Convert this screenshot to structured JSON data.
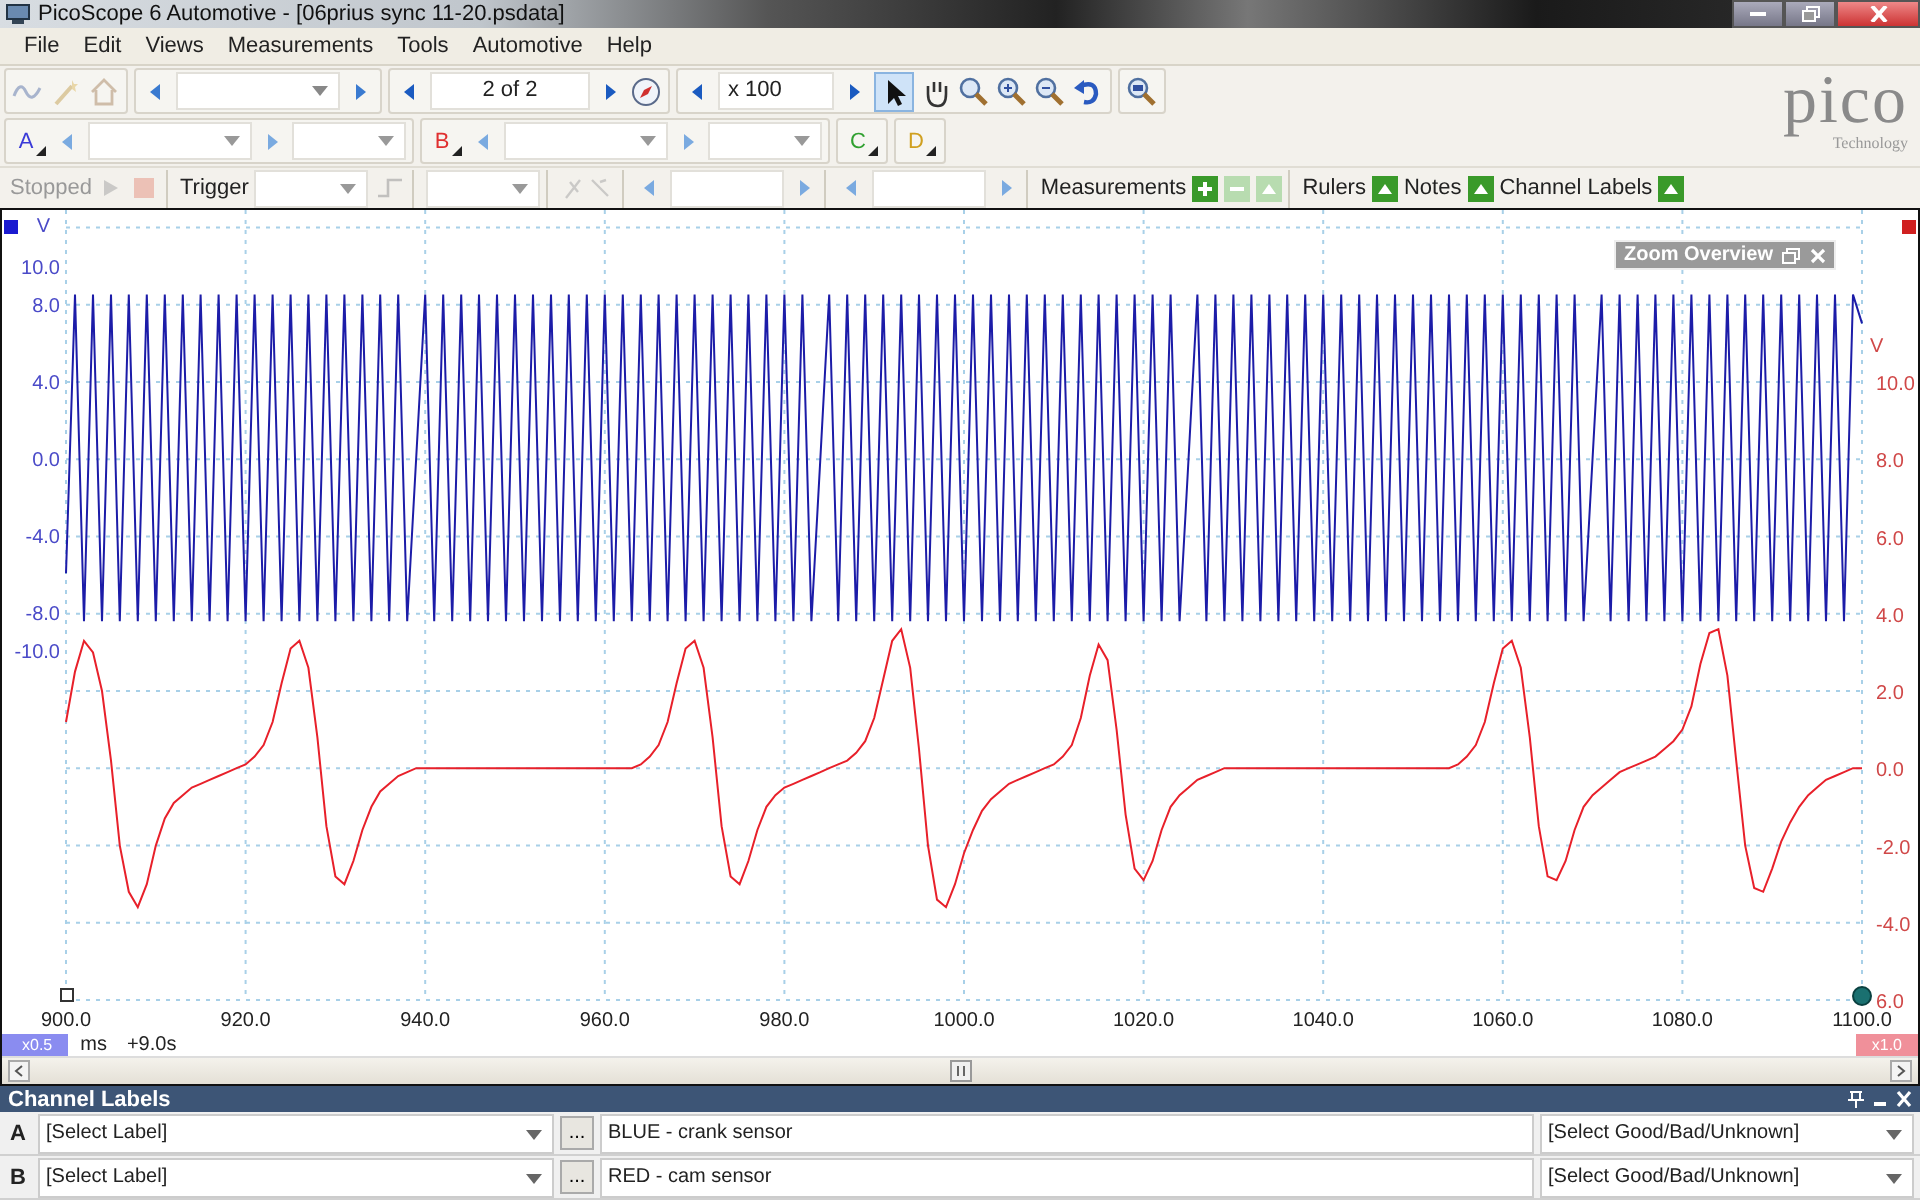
{
  "window": {
    "title": "PicoScope 6 Automotive - [06prius sync 11-20.psdata]"
  },
  "menu": [
    {
      "label": "File"
    },
    {
      "label": "Edit"
    },
    {
      "label": "Views"
    },
    {
      "label": "Measurements"
    },
    {
      "label": "Tools"
    },
    {
      "label": "Automotive"
    },
    {
      "label": "Help"
    }
  ],
  "toolbar": {
    "page_field": "2 of 2",
    "zoom_field": "x 100"
  },
  "channel_buttons": [
    {
      "label": "A",
      "color": "#3a3ad8"
    },
    {
      "label": "B",
      "color": "#e03030"
    },
    {
      "label": "C",
      "color": "#30a030"
    },
    {
      "label": "D",
      "color": "#d0a020"
    }
  ],
  "logo": {
    "text": "pico",
    "subtitle": "Technology"
  },
  "capture_bar": {
    "status": "Stopped",
    "trigger": "Trigger",
    "measurements": "Measurements",
    "rulers": "Rulers",
    "notes": "Notes",
    "channel_labels": "Channel Labels"
  },
  "scope": {
    "zoom_overview": "Zoom Overview",
    "x_scale_badge": "x0.5",
    "time_offset": "+9.0s",
    "right_scale_badge": "x1.0",
    "channel_a": {
      "chart_data": {
        "type": "line",
        "xlim": [
          900,
          1100
        ],
        "ylim": [
          -10,
          12.9
        ],
        "annotations": [
          {
            "text": "V"
          }
        ],
        "x": [
          900,
          901,
          902,
          903,
          904,
          905,
          906,
          907,
          908,
          909,
          910,
          911,
          912,
          913,
          914,
          915,
          916,
          917,
          918,
          919,
          920,
          921,
          922,
          923,
          924,
          925,
          926,
          927,
          928,
          929,
          930,
          931,
          932,
          933,
          934,
          935,
          936,
          937,
          938,
          939,
          940,
          941,
          942,
          943,
          944,
          945,
          946,
          947,
          948,
          949,
          950,
          951,
          952,
          953,
          954,
          955,
          956,
          957,
          958,
          959,
          960,
          961,
          962,
          963,
          964,
          965,
          966,
          967,
          968,
          969,
          970,
          971,
          972,
          973,
          974,
          975,
          976,
          977,
          978,
          979,
          980,
          981,
          982,
          983,
          984,
          985,
          986,
          987,
          988,
          989,
          990,
          991,
          992,
          993,
          994,
          995,
          996,
          997,
          998,
          999,
          1000,
          1001,
          1002,
          1003,
          1004,
          1005,
          1006,
          1007,
          1008,
          1009,
          1010,
          1011,
          1012,
          1013,
          1014,
          1015,
          1016,
          1017,
          1018,
          1019,
          1020,
          1021,
          1022,
          1023,
          1024,
          1025,
          1026,
          1027,
          1028,
          1029,
          1030,
          1031,
          1032,
          1033,
          1034,
          1035,
          1036,
          1037,
          1038,
          1039,
          1040,
          1041,
          1042,
          1043,
          1044,
          1045,
          1046,
          1047,
          1048,
          1049,
          1050,
          1051,
          1052,
          1053,
          1054,
          1055,
          1056,
          1057,
          1058,
          1059,
          1060,
          1061,
          1062,
          1063,
          1064,
          1065,
          1066,
          1067,
          1068,
          1069,
          1070,
          1071,
          1072,
          1073,
          1074,
          1075,
          1076,
          1077,
          1078,
          1079,
          1080,
          1081,
          1082,
          1083,
          1084,
          1085,
          1086,
          1087,
          1088,
          1089,
          1090,
          1091,
          1092,
          1093,
          1094,
          1095,
          1096,
          1097,
          1098,
          1099,
          1100
        ],
        "yticks": [
          {
            "value": 10,
            "label": "10.0"
          },
          {
            "value": 8,
            "label": "8.0"
          },
          {
            "value": 4,
            "label": "4.0"
          },
          {
            "value": 0,
            "label": "0.0"
          },
          {
            "value": -4,
            "label": "-4.0"
          },
          {
            "value": -8,
            "label": "-8.0"
          },
          {
            "value": -10,
            "label": "-10.0"
          }
        ],
        "series": [
          {
            "color": "#1c1ca8",
            "values": [
              -6,
              8.5,
              -8.5,
              8.5,
              -8.5,
              8.5,
              -8.5,
              8.5,
              -8.5,
              8.5,
              -8.5,
              8.5,
              -8.5,
              8.5,
              -8.5,
              8.5,
              -8.5,
              8.5,
              -8.5,
              8.5,
              -8.5,
              8.5,
              -8.5,
              8.5,
              -8.5,
              8.5,
              -8.5,
              8.5,
              -8.5,
              8.5,
              -8.5,
              8.5,
              -8.5,
              8.5,
              -8.5,
              8.5,
              -8.5,
              8.5,
              -8.5,
              0,
              8.5,
              -8.5,
              8.5,
              -8.5,
              8.5,
              -8.5,
              8.5,
              -8.5,
              8.5,
              -8.5,
              8.5,
              -8.5,
              8.5,
              -8.5,
              8.5,
              -8.5,
              8.5,
              -8.5,
              8.5,
              -8.5,
              8.5,
              -8.5,
              8.5,
              -8.5,
              8.5,
              -8.5,
              8.5,
              -8.5,
              8.5,
              -8.5,
              8.5,
              -8.5,
              8.5,
              -8.5,
              8.5,
              -8.5,
              8.5,
              -8.5,
              8.5,
              -8.5,
              8.5,
              -8.5,
              8.5,
              -8.5,
              0,
              8.5,
              -8.5,
              8.5,
              -8.5,
              8.5,
              -8.5,
              8.5,
              -8.5,
              8.5,
              -8.5,
              8.5,
              -8.5,
              8.5,
              -8.5,
              8.5,
              -8.5,
              8.5,
              -8.5,
              8.5,
              -8.5,
              8.5,
              -8.5,
              8.5,
              -8.5,
              8.5,
              -8.5,
              8.5,
              -8.5,
              8.5,
              -8.5,
              8.5,
              -8.5,
              8.5,
              -8.5,
              8.5,
              -8.5,
              8.5,
              -8.5,
              8.5,
              -8.5,
              0,
              8.5,
              -8.5,
              8.5,
              -8.5,
              8.5,
              -8.5,
              8.5,
              -8.5,
              8.5,
              -8.5,
              8.5,
              -8.5,
              8.5,
              -8.5,
              8.5,
              -8.5,
              8.5,
              -8.5,
              8.5,
              -8.5,
              8.5,
              -8.5,
              8.5,
              -8.5,
              8.5,
              -8.5,
              8.5,
              -8.5,
              8.5,
              -8.5,
              8.5,
              -8.5,
              8.5,
              -8.5,
              8.5,
              -8.5,
              8.5,
              -8.5,
              8.5,
              -8.5,
              8.5,
              -8.5,
              8.5,
              -8.5,
              0,
              8.5,
              -8.5,
              8.5,
              -8.5,
              8.5,
              -8.5,
              8.5,
              -8.5,
              8.5,
              -8.5,
              8.5,
              -8.5,
              8.5,
              -8.5,
              8.5,
              -8.5,
              8.5,
              -8.5,
              8.5,
              -8.5,
              8.5,
              -8.5,
              8.5,
              -8.5,
              8.5,
              -8.5,
              8.5,
              -8.5,
              8.5,
              7
            ]
          }
        ]
      }
    },
    "channel_b": {
      "chart_data": {
        "type": "line",
        "xlabel": "ms",
        "xlim": [
          900,
          1100
        ],
        "ylim": [
          -6,
          10
        ],
        "grid": true,
        "annotations": [
          {
            "text": "V"
          }
        ],
        "x": [
          900,
          901,
          902,
          903,
          904,
          905,
          906,
          907,
          908,
          909,
          910,
          911,
          912,
          913,
          914,
          915,
          916,
          917,
          918,
          919,
          920,
          921,
          922,
          923,
          924,
          925,
          926,
          927,
          928,
          929,
          930,
          931,
          932,
          933,
          934,
          935,
          936,
          937,
          938,
          939,
          940,
          941,
          942,
          943,
          944,
          945,
          946,
          947,
          948,
          949,
          950,
          951,
          952,
          953,
          954,
          955,
          956,
          957,
          958,
          959,
          960,
          961,
          962,
          963,
          964,
          965,
          966,
          967,
          968,
          969,
          970,
          971,
          972,
          973,
          974,
          975,
          976,
          977,
          978,
          979,
          980,
          981,
          982,
          983,
          984,
          985,
          986,
          987,
          988,
          989,
          990,
          991,
          992,
          993,
          994,
          995,
          996,
          997,
          998,
          999,
          1000,
          1001,
          1002,
          1003,
          1004,
          1005,
          1006,
          1007,
          1008,
          1009,
          1010,
          1011,
          1012,
          1013,
          1014,
          1015,
          1016,
          1017,
          1018,
          1019,
          1020,
          1021,
          1022,
          1023,
          1024,
          1025,
          1026,
          1027,
          1028,
          1029,
          1030,
          1031,
          1032,
          1033,
          1034,
          1035,
          1036,
          1037,
          1038,
          1039,
          1040,
          1041,
          1042,
          1043,
          1044,
          1045,
          1046,
          1047,
          1048,
          1049,
          1050,
          1051,
          1052,
          1053,
          1054,
          1055,
          1056,
          1057,
          1058,
          1059,
          1060,
          1061,
          1062,
          1063,
          1064,
          1065,
          1066,
          1067,
          1068,
          1069,
          1070,
          1071,
          1072,
          1073,
          1074,
          1075,
          1076,
          1077,
          1078,
          1079,
          1080,
          1081,
          1082,
          1083,
          1084,
          1085,
          1086,
          1087,
          1088,
          1089,
          1090,
          1091,
          1092,
          1093,
          1094,
          1095,
          1096,
          1097,
          1098,
          1099,
          1100
        ],
        "xticks": [
          {
            "value": 900,
            "label": "900.0"
          },
          {
            "value": 920,
            "label": "920.0"
          },
          {
            "value": 940,
            "label": "940.0"
          },
          {
            "value": 960,
            "label": "960.0"
          },
          {
            "value": 980,
            "label": "980.0"
          },
          {
            "value": 1000,
            "label": "1000.0"
          },
          {
            "value": 1020,
            "label": "1020.0"
          },
          {
            "value": 1040,
            "label": "1040.0"
          },
          {
            "value": 1060,
            "label": "1060.0"
          },
          {
            "value": 1080,
            "label": "1080.0"
          },
          {
            "value": 1100,
            "label": "1100.0"
          }
        ],
        "yticks": [
          {
            "value": 10,
            "label": "10.0"
          },
          {
            "value": 8,
            "label": "8.0"
          },
          {
            "value": 6,
            "label": "6.0"
          },
          {
            "value": 4,
            "label": "4.0"
          },
          {
            "value": 2,
            "label": "2.0"
          },
          {
            "value": 0,
            "label": "0.0"
          },
          {
            "value": -2,
            "label": "-2.0"
          },
          {
            "value": -4,
            "label": "-4.0"
          },
          {
            "value": -6,
            "label": "6.0"
          }
        ],
        "series": [
          {
            "color": "#e8202a",
            "values": [
              1.2,
              2.5,
              3.3,
              3.0,
              2.0,
              0.2,
              -2.0,
              -3.2,
              -3.6,
              -3.0,
              -2.0,
              -1.3,
              -0.9,
              -0.7,
              -0.5,
              -0.4,
              -0.3,
              -0.2,
              -0.1,
              0.0,
              0.1,
              0.3,
              0.6,
              1.2,
              2.2,
              3.1,
              3.3,
              2.6,
              0.8,
              -1.5,
              -2.8,
              -3.0,
              -2.4,
              -1.6,
              -1.0,
              -0.6,
              -0.4,
              -0.2,
              -0.1,
              0,
              0,
              0,
              0,
              0,
              0,
              0,
              0,
              0,
              0,
              0,
              0,
              0,
              0,
              0,
              0,
              0,
              0,
              0,
              0,
              0,
              0,
              0,
              0,
              0,
              0.1,
              0.3,
              0.6,
              1.2,
              2.2,
              3.1,
              3.3,
              2.6,
              0.8,
              -1.5,
              -2.8,
              -3.0,
              -2.4,
              -1.6,
              -1.0,
              -0.7,
              -0.5,
              -0.4,
              -0.3,
              -0.2,
              -0.1,
              0.0,
              0.1,
              0.2,
              0.4,
              0.7,
              1.3,
              2.3,
              3.3,
              3.6,
              2.6,
              0.5,
              -2.0,
              -3.4,
              -3.6,
              -3.0,
              -2.2,
              -1.6,
              -1.1,
              -0.8,
              -0.6,
              -0.4,
              -0.3,
              -0.2,
              -0.1,
              0.0,
              0.1,
              0.3,
              0.6,
              1.3,
              2.4,
              3.2,
              2.8,
              1.0,
              -1.2,
              -2.6,
              -2.9,
              -2.4,
              -1.6,
              -1.0,
              -0.7,
              -0.5,
              -0.3,
              -0.2,
              -0.1,
              0,
              0,
              0,
              0,
              0,
              0,
              0,
              0,
              0,
              0,
              0,
              0,
              0,
              0,
              0,
              0,
              0,
              0,
              0,
              0,
              0,
              0,
              0,
              0,
              0,
              0,
              0.1,
              0.3,
              0.6,
              1.2,
              2.2,
              3.1,
              3.3,
              2.6,
              0.8,
              -1.5,
              -2.8,
              -2.9,
              -2.4,
              -1.6,
              -1.0,
              -0.7,
              -0.5,
              -0.3,
              -0.1,
              0.0,
              0.1,
              0.2,
              0.3,
              0.5,
              0.7,
              1.0,
              1.6,
              2.7,
              3.5,
              3.6,
              2.4,
              0.2,
              -2.0,
              -3.1,
              -3.2,
              -2.6,
              -1.9,
              -1.4,
              -1.0,
              -0.7,
              -0.5,
              -0.3,
              -0.2,
              -0.1,
              0.0,
              0.0
            ]
          }
        ]
      }
    }
  },
  "channel_labels_panel": {
    "title": "Channel Labels",
    "rows": [
      {
        "channel": "A",
        "label_select": "[Select Label]",
        "browse_button": "...",
        "description": "BLUE - crank sensor",
        "status_select": "[Select Good/Bad/Unknown]"
      },
      {
        "channel": "B",
        "label_select": "[Select Label]",
        "browse_button": "...",
        "description": "RED - cam sensor",
        "status_select": "[Select Good/Bad/Unknown]"
      }
    ]
  }
}
